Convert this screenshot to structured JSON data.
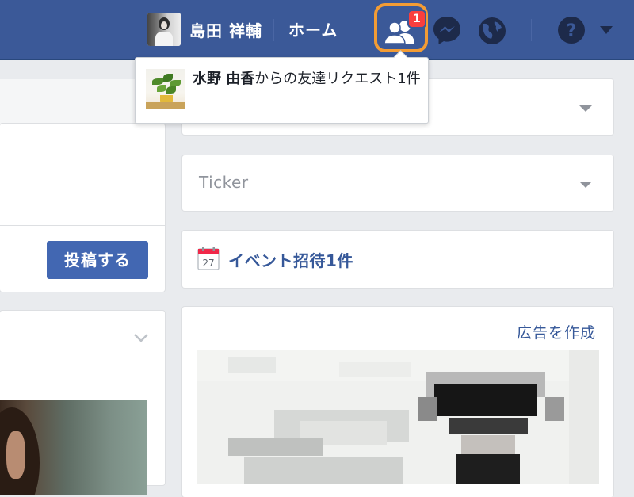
{
  "header": {
    "profile_name": "島田 祥輔",
    "home_label": "ホーム",
    "friend_requests_count": "1"
  },
  "notification": {
    "sender_name": "水野 由香",
    "message": "からの友達リクエスト1件"
  },
  "composer": {
    "post_button_label": "投稿する"
  },
  "sidebar": {
    "ticker_label": "Ticker",
    "event_invites": "イベント招待1件",
    "calendar_day": "27",
    "create_ad_label": "広告を作成"
  },
  "colors": {
    "header_bg": "#3b5998",
    "highlight": "#f39c34",
    "badge": "#fa3e3e",
    "button": "#4267b2",
    "link": "#365899"
  }
}
